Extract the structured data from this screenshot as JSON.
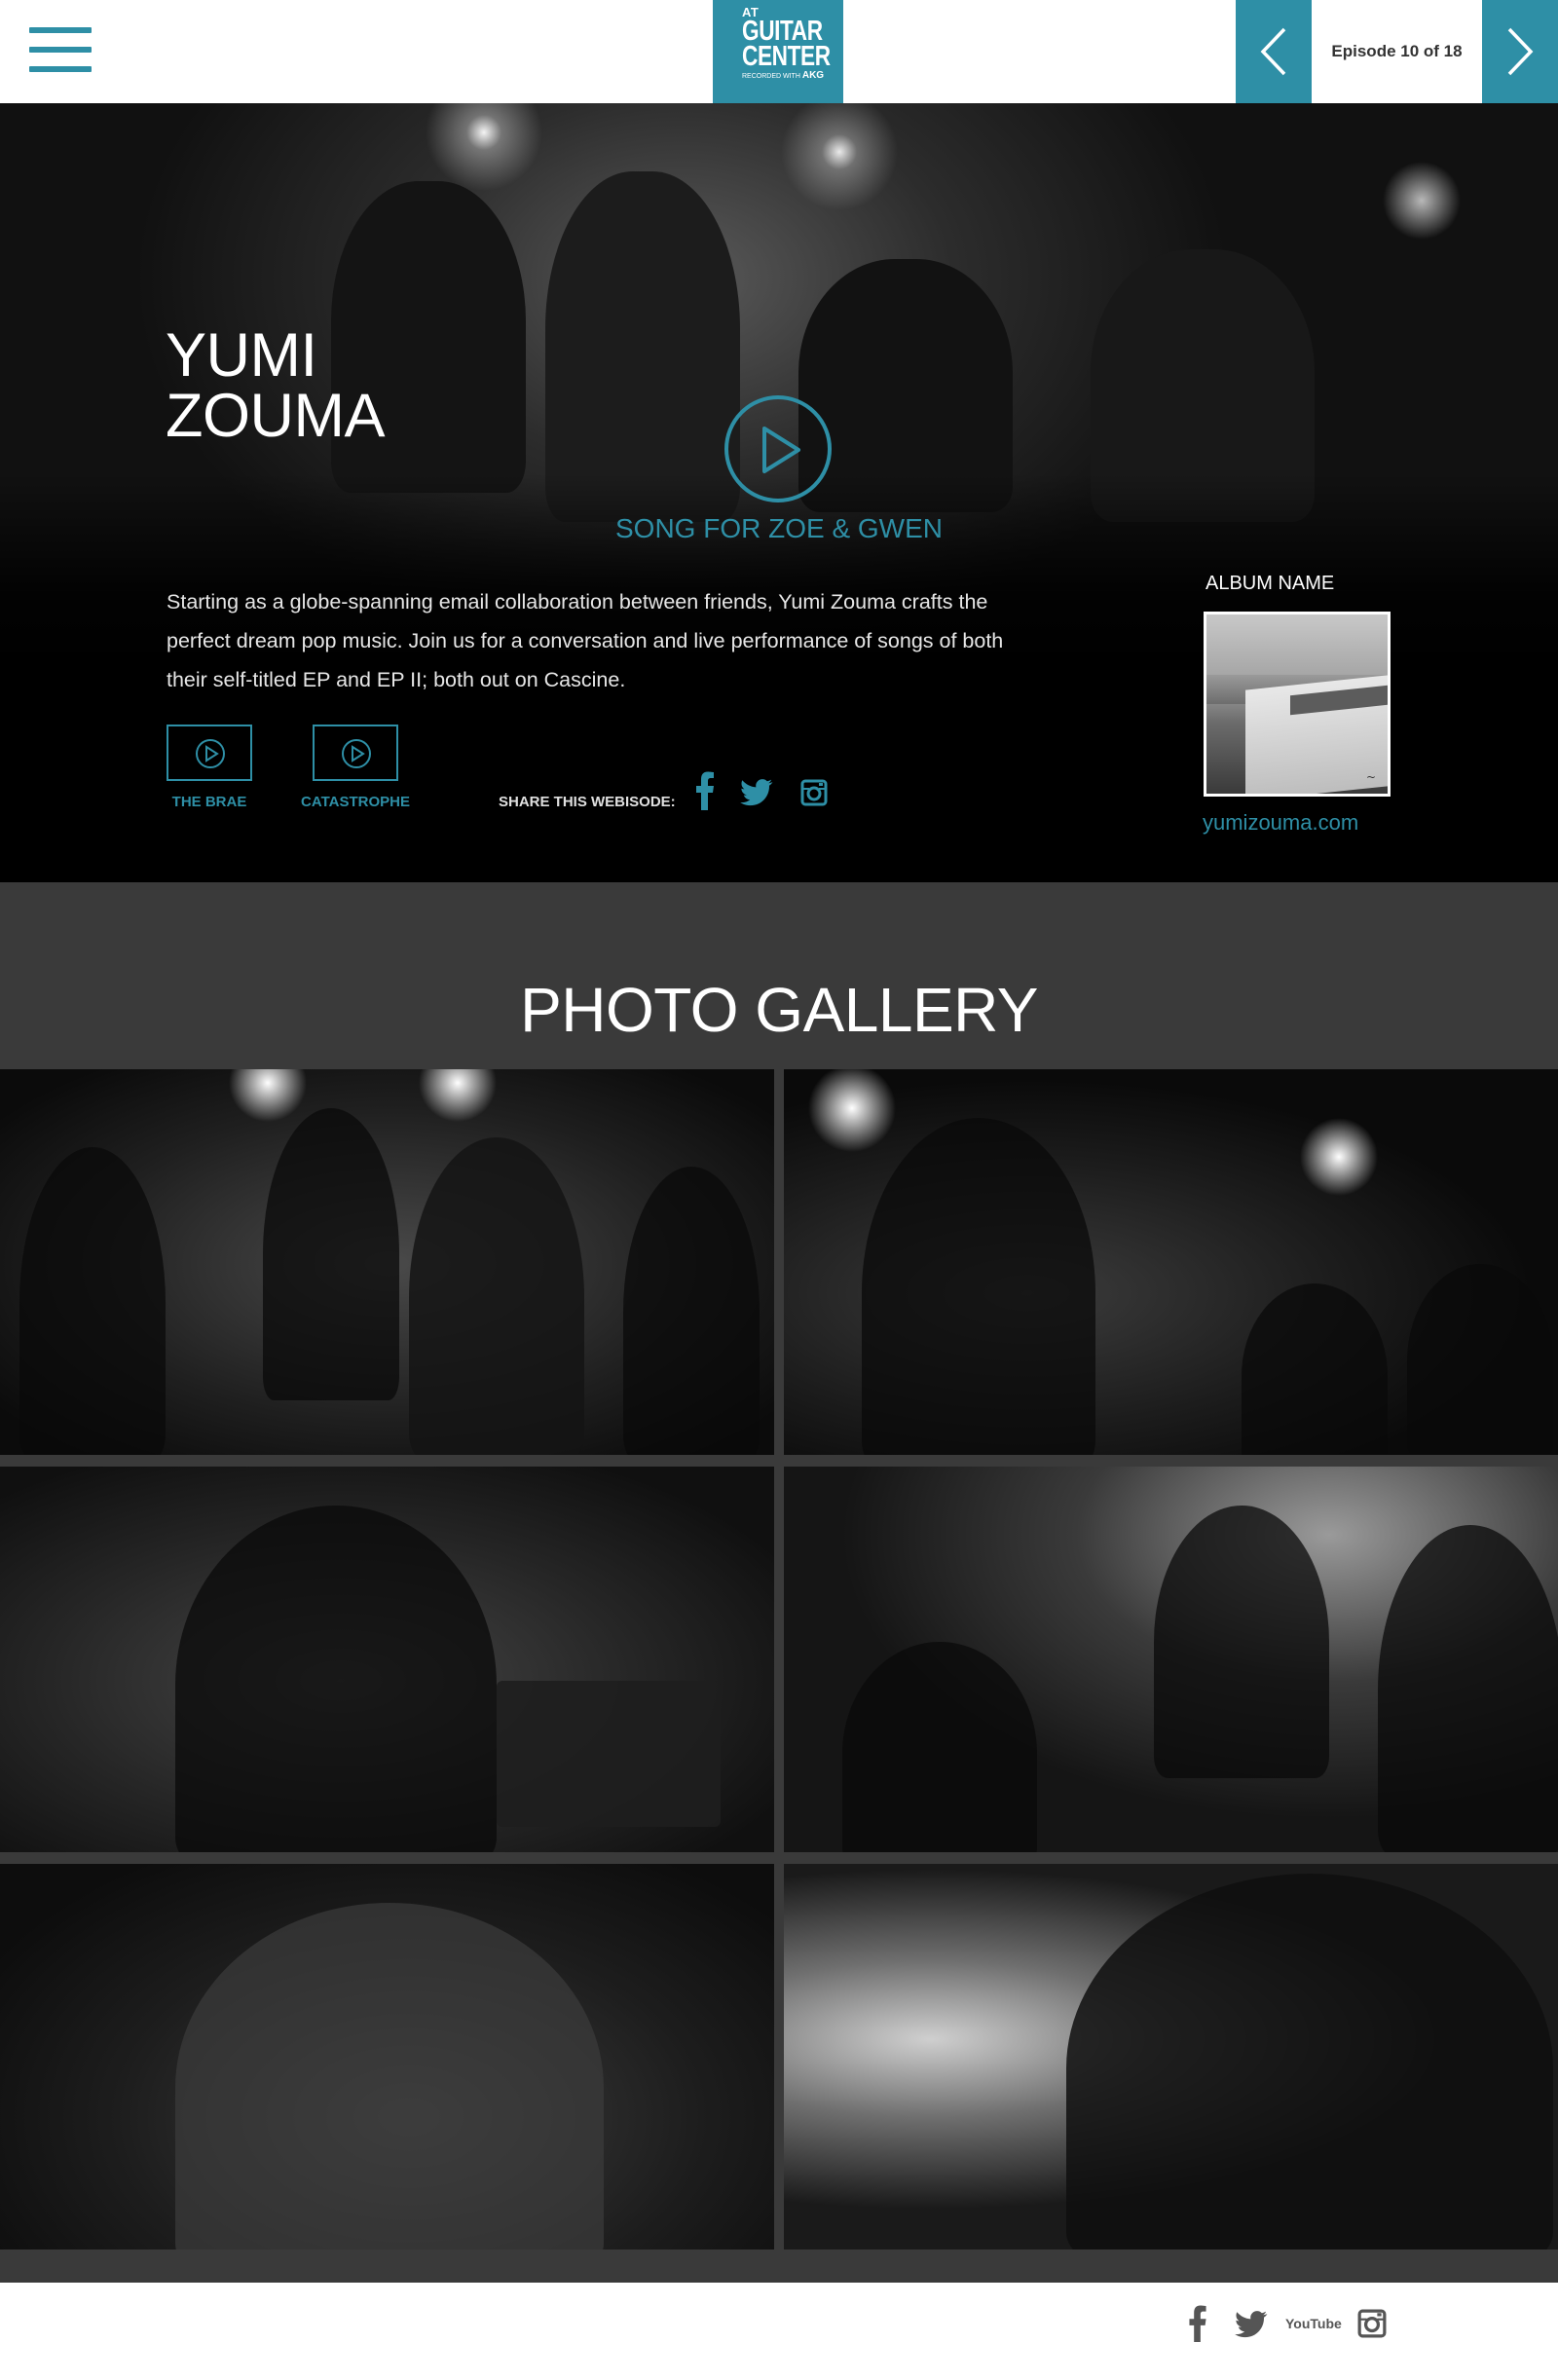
{
  "header": {
    "menu_icon": "hamburger-menu-icon",
    "logo": {
      "line1": "AT",
      "line2": "GUITAR",
      "line3": "CENTER",
      "line4": "RECORDED WITH",
      "brand": "AKG"
    },
    "episode_label": "Episode 10 of 18",
    "prev_icon": "chevron-left-icon",
    "next_icon": "chevron-right-icon"
  },
  "hero": {
    "band_name_line1": "YUMI",
    "band_name_line2": "ZOUMA",
    "song_title": "SONG FOR ZOE & GWEN",
    "description": "Starting as a globe-spanning email collaboration between friends, Yumi Zouma crafts the perfect dream pop music. Join us for a conversation and live performance of songs of both their self-titled EP and EP II; both out on Cascine.",
    "videos": [
      {
        "label": "THE BRAE"
      },
      {
        "label": "CATASTROPHE"
      }
    ],
    "share_label": "SHARE THIS WEBISODE:",
    "share_icons": [
      "facebook-icon",
      "twitter-icon",
      "instagram-icon"
    ],
    "album_label": "ALBUM NAME",
    "website": "yumizouma.com"
  },
  "gallery": {
    "title": "PHOTO GALLERY",
    "photo_count": 6
  },
  "footer": {
    "social_icons": [
      "facebook-icon",
      "twitter-icon",
      "youtube-icon",
      "instagram-icon"
    ],
    "youtube_text": "YouTube"
  },
  "colors": {
    "accent": "#2e8fa6",
    "gallery_bg": "#3a3a3a",
    "hero_bg": "#000000"
  }
}
